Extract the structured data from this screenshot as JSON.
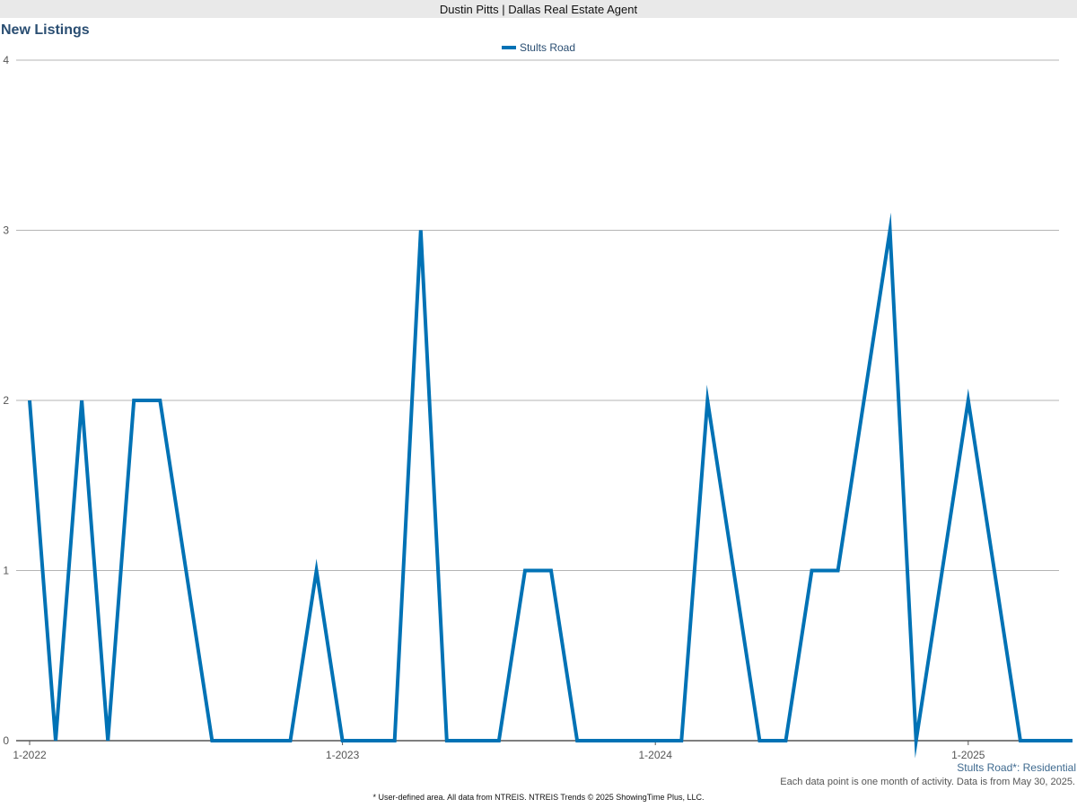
{
  "header": {
    "agent": "Dustin Pitts | Dallas Real Estate Agent"
  },
  "chart_data": {
    "type": "line",
    "title": "New Listings",
    "xlabel": "",
    "ylabel": "",
    "ylim": [
      0,
      4
    ],
    "y_ticks": [
      0,
      1,
      2,
      3,
      4
    ],
    "x_tick_labels": [
      "1-2022",
      "1-2023",
      "1-2024",
      "1-2025"
    ],
    "grid": true,
    "legend_position": "top-center",
    "x": [
      "1-2022",
      "2-2022",
      "3-2022",
      "4-2022",
      "5-2022",
      "6-2022",
      "7-2022",
      "8-2022",
      "9-2022",
      "10-2022",
      "11-2022",
      "12-2022",
      "1-2023",
      "2-2023",
      "3-2023",
      "4-2023",
      "5-2023",
      "6-2023",
      "7-2023",
      "8-2023",
      "9-2023",
      "10-2023",
      "11-2023",
      "12-2023",
      "1-2024",
      "2-2024",
      "3-2024",
      "4-2024",
      "5-2024",
      "6-2024",
      "7-2024",
      "8-2024",
      "9-2024",
      "10-2024",
      "11-2024",
      "12-2024",
      "1-2025",
      "2-2025",
      "3-2025",
      "4-2025",
      "5-2025"
    ],
    "series": [
      {
        "name": "Stults Road",
        "color": "#0072b5",
        "values": [
          2,
          0,
          2,
          0,
          2,
          2,
          1,
          0,
          0,
          0,
          0,
          1,
          0,
          0,
          0,
          3,
          0,
          0,
          0,
          1,
          1,
          0,
          0,
          0,
          0,
          0,
          2,
          1,
          0,
          0,
          1,
          1,
          2,
          3,
          0,
          1,
          2,
          1,
          0,
          0,
          0
        ]
      }
    ]
  },
  "area_label": "Stults Road*: Residential",
  "note": "Each data point is one month of activity. Data is from May 30, 2025.",
  "footer": "* User-defined area. All data from NTREIS. NTREIS Trends © 2025 ShowingTime Plus, LLC."
}
